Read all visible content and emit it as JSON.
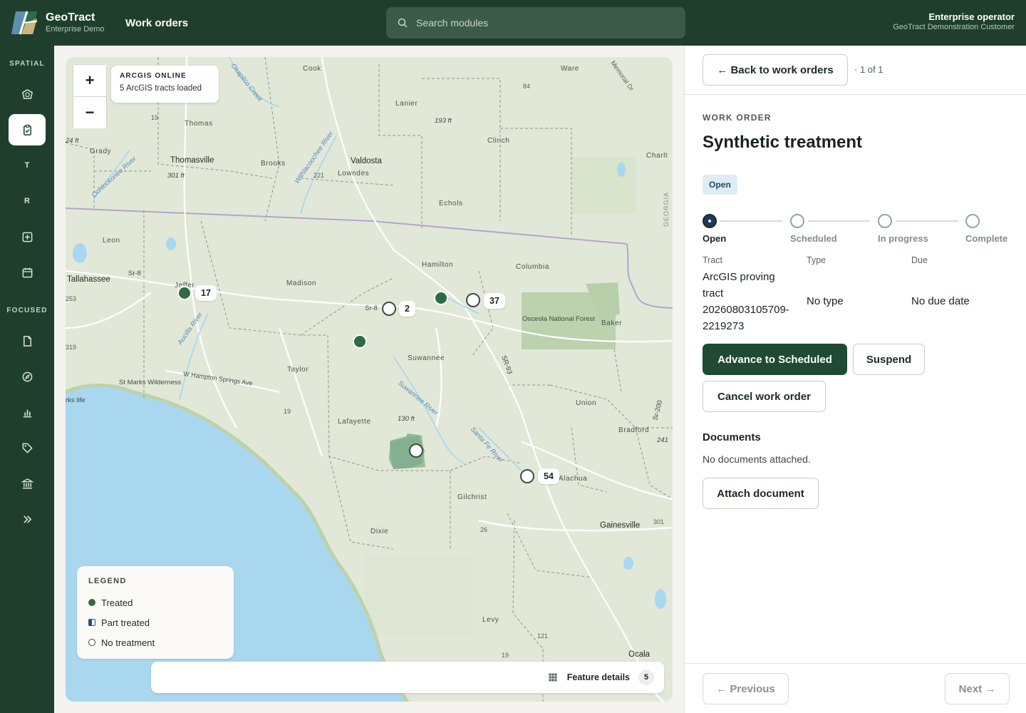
{
  "brand": {
    "name": "GeoTract",
    "subtitle": "Enterprise Demo"
  },
  "header": {
    "module": "Work orders",
    "search_placeholder": "Search modules",
    "user_name": "Enterprise operator",
    "user_org": "GeoTract Demonstration Customer"
  },
  "sidebar": {
    "section_spatial": "SPATIAL",
    "section_focused": "FOCUSED",
    "letter_t": "T",
    "letter_r": "R"
  },
  "map": {
    "source_title": "ARCGIS ONLINE",
    "source_status": "5 ArcGIS tracts loaded",
    "zoom_in": "+",
    "zoom_out": "−",
    "labels": {
      "tallahassee": "Tallahassee",
      "thomasville": "Thomasville",
      "valdosta": "Valdosta",
      "gainesville": "Gainesville",
      "madison": "Madison",
      "hamilton": "Hamilton",
      "columbia": "Columbia",
      "suwannee": "Suwannee",
      "taylor": "Taylor",
      "lafayette": "Lafayette",
      "gilchrist": "Gilchrist",
      "dixie": "Dixie",
      "levy": "Levy",
      "union": "Union",
      "bradford": "Bradford",
      "baker": "Baker",
      "echols": "Echols",
      "clinch": "Clinch",
      "lanier": "Lanier",
      "brooks": "Brooks",
      "lowndes": "Lowndes",
      "thomas": "Thomas",
      "grady": "Grady",
      "cook": "Cook",
      "ware": "Ware",
      "leon": "Leon",
      "jefferson": "Jeffer",
      "alachua": "Alachua",
      "ocala": "Ocala",
      "charlton": "Charlt",
      "georgia": "GEORGIA",
      "osceola": "Osceola National Forest",
      "stmarks": "St Marks Wilderness",
      "whampton": "W Hampton Springs Ave",
      "sr8": "Sr-8",
      "sr8b": "Sr-8",
      "sr93": "SR-93",
      "sr200": "Sr-200",
      "h193": "193 ft",
      "h301": "301 ft",
      "h130": "130 ft",
      "h24": "24 ft",
      "h241": "241",
      "okapilco": "Okapilco Creek",
      "withlacoochee": "Withlacoochee River",
      "ochlockonee": "Ochlockonee River",
      "aucilla": "Aucilla River",
      "suwanneeriver": "Suwannee River",
      "santafe": "Santa Fe River",
      "memorial": "Memorial Dr",
      "r84": "84",
      "r19": "19",
      "r19b": "19",
      "r221": "221",
      "r26": "26",
      "r121": "121",
      "r19c": "19",
      "r301": "301",
      "r319": "319",
      "r253": "253",
      "wks": "rks life"
    },
    "markers": [
      {
        "label": "17",
        "status": "treated"
      },
      {
        "label": "2",
        "status": "none"
      },
      {
        "label": "37",
        "status": "none"
      },
      {
        "label": "54",
        "status": "none"
      }
    ],
    "legend": {
      "title": "LEGEND",
      "items": [
        {
          "label": "Treated",
          "color": "#2e6b45"
        },
        {
          "label": "Part treated",
          "color": "#2a4f7a"
        },
        {
          "label": "No treatment",
          "color": "#ffffff"
        }
      ]
    },
    "feature_details": {
      "label": "Feature details",
      "count": "5"
    }
  },
  "panel": {
    "back_label": "← Back to work orders",
    "pager": "· 1 of 1",
    "section_label": "WORK ORDER",
    "title": "Synthetic treatment",
    "status": "Open",
    "steps": [
      "Open",
      "Scheduled",
      "In progress",
      "Complete"
    ],
    "tract_header": "Tract",
    "type_header": "Type",
    "due_header": "Due",
    "tract_value_1": "ArcGIS proving",
    "tract_value_2": "tract",
    "tract_value_3": "20260803105709-",
    "tract_value_4": "2219273",
    "type_value": "No type",
    "due_value": "No due date",
    "advance_label": "Advance to Scheduled",
    "suspend_label": "Suspend",
    "cancel_label": "Cancel work order",
    "documents_title": "Documents",
    "documents_empty": "No documents attached.",
    "attach_label": "Attach document",
    "previous_label": "← Previous",
    "next_label": "Next →"
  }
}
